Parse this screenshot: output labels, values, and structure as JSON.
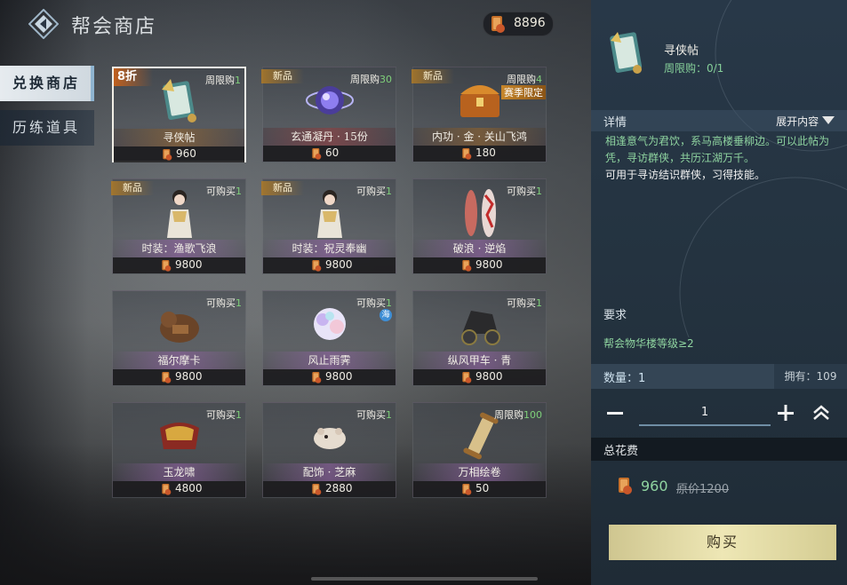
{
  "header": {
    "title": "帮会商店",
    "currency_value": "8896",
    "currency_icon": "coin-icon"
  },
  "tabs": [
    {
      "label": "兑换商店",
      "active": true
    },
    {
      "label": "历练道具",
      "active": false
    }
  ],
  "items": [
    {
      "name": "寻侠帖",
      "price": "960",
      "limit_text": "周限购",
      "limit_count": "1",
      "tag": "8折",
      "tag_type": "discount",
      "selected": true,
      "icon": "book-icon"
    },
    {
      "name": "玄通凝丹 · 15份",
      "price": "60",
      "limit_text": "周限购",
      "limit_count": "30",
      "tag": "新品",
      "tag_type": "new",
      "icon": "orb-icon"
    },
    {
      "name": "内功 · 金 · 关山飞鸿",
      "price": "180",
      "limit_text": "周限购",
      "limit_count": "4",
      "tag": "新品",
      "tag_type": "new",
      "season": "赛季限定",
      "icon": "chest-icon"
    },
    {
      "name": "时装：渔歌飞浪",
      "price": "9800",
      "limit_text": "可购买",
      "limit_count": "1",
      "tag": "新品",
      "tag_type": "new",
      "icon": "costume-icon"
    },
    {
      "name": "时装：祝灵奉幽",
      "price": "9800",
      "limit_text": "可购买",
      "limit_count": "1",
      "tag": "新品",
      "tag_type": "new",
      "icon": "costume-icon"
    },
    {
      "name": "破浪 · 逆焰",
      "price": "9800",
      "limit_text": "可购买",
      "limit_count": "1",
      "icon": "surfboard-icon"
    },
    {
      "name": "福尔摩卡",
      "price": "9800",
      "limit_text": "可购买",
      "limit_count": "1",
      "icon": "mount-icon"
    },
    {
      "name": "风止雨霁",
      "price": "9800",
      "limit_text": "可购买",
      "limit_count": "1",
      "sea": "海",
      "icon": "effect-icon"
    },
    {
      "name": "纵风甲车 · 青",
      "price": "9800",
      "limit_text": "可购买",
      "limit_count": "1",
      "icon": "chariot-icon"
    },
    {
      "name": "玉龙啸",
      "price": "4800",
      "limit_text": "可购买",
      "limit_count": "1",
      "icon": "saddle-icon"
    },
    {
      "name": "配饰 · 芝麻",
      "price": "2880",
      "limit_text": "可购买",
      "limit_count": "1",
      "icon": "hamster-icon"
    },
    {
      "name": "万相绘卷",
      "price": "50",
      "limit_text": "周限购",
      "limit_count": "100",
      "icon": "scroll-icon"
    }
  ],
  "detail": {
    "name": "寻侠帖",
    "limit": "周限购：0/1",
    "details_label": "详情",
    "expand_label": "展开内容",
    "desc_green": "相逢意气为君饮，系马高楼垂柳边。可以此帖为凭，寻访群侠，共历江湖万千。",
    "desc_white": "可用于寻访结识群侠，习得技能。",
    "req_label": "要求",
    "req_value": "帮会物华楼等级≥2",
    "qty_label": "数量：1",
    "own_label": "拥有：109",
    "qty_value": "1",
    "total_label": "总花费",
    "cost": "960",
    "orig_cost": "原价1200",
    "buy_label": "购买"
  },
  "colors": {
    "accent_green": "#8fd4a0",
    "panel_bg": "#283848",
    "buy_button": "#eee7b5",
    "discount": "#c0601e"
  }
}
